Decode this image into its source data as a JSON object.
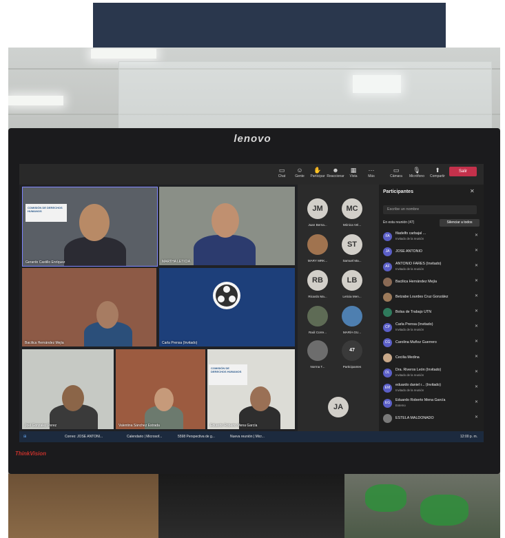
{
  "monitor": {
    "brand": "lenovo",
    "model": "ThinkVision"
  },
  "toolbar": {
    "buttons": [
      "Chat",
      "Gente",
      "Participar",
      "Reaccionar",
      "Vista",
      "Más",
      "Cámara",
      "Micrófono",
      "Compartir"
    ],
    "leave": "Salir"
  },
  "tiles": [
    {
      "name": "Gerardo Castillo Enríquez",
      "logo": "COMISIÓN DE DERECHOS HUMANOS"
    },
    {
      "name": "MARTHA LETICIA"
    },
    {
      "name": "Bacilica Hernández Mejía"
    },
    {
      "name": "Carla Prensa (Invitado)"
    },
    {
      "name": "Joel Gonzalez Perez"
    },
    {
      "name": "Valentina Sánchez Estrada"
    },
    {
      "name": "Eduardo Roberto Mena García",
      "logo": "COMISIÓN DE DERECHOS HUMANOS"
    }
  ],
  "avatars": [
    {
      "initials": "JM",
      "name": "Juan Berna..."
    },
    {
      "initials": "MC",
      "name": "Mónica Vel..."
    },
    {
      "initials": "",
      "name": "MARY MRK..."
    },
    {
      "initials": "ST",
      "name": "Samuel Ma..."
    },
    {
      "initials": "RB",
      "name": "Ricardo Ma..."
    },
    {
      "initials": "LB",
      "name": "Leticia Men..."
    },
    {
      "initials": "",
      "name": "Raúl Corre..."
    },
    {
      "initials": "",
      "name": "MARÍA GU..."
    },
    {
      "initials": "",
      "name": "Norma T..."
    },
    {
      "initials": "47",
      "name": "Participantes"
    },
    {
      "initials": "JA",
      "name": ""
    }
  ],
  "panel": {
    "title": "Participantes",
    "search_placeholder": "Escribe un nombre",
    "section": "En esta reunión (47)",
    "mute_all": "Silenciar a todos",
    "participants": [
      {
        "initials": "FA",
        "name": "filadelfo carbajal ... ",
        "sub": "Invitado de la reunión"
      },
      {
        "initials": "JA",
        "name": "JOSE ANTONIO",
        "sub": ""
      },
      {
        "initials": "AF",
        "name": "ANTONIO FARES (Invitado)",
        "sub": "Invitado de la reunión"
      },
      {
        "initials": "",
        "name": "Bacilica Hernández Mejía",
        "sub": ""
      },
      {
        "initials": "",
        "name": "Betzabe Lourdes Cruz González",
        "sub": ""
      },
      {
        "initials": "",
        "name": "Bolsa de Trabajo UTN",
        "sub": ""
      },
      {
        "initials": "CP",
        "name": "Carla Prensa (Invitado)",
        "sub": "Invitado de la reunión"
      },
      {
        "initials": "CG",
        "name": "Carolina Muñoz Guerrero",
        "sub": ""
      },
      {
        "initials": "",
        "name": "Cecilia Medina",
        "sub": ""
      },
      {
        "initials": "DL",
        "name": "Dra. Riveros León (Invitado)",
        "sub": "Invitado de la reunión"
      },
      {
        "initials": "EM",
        "name": "eduardo daniel r... (Invitado)",
        "sub": "Invitado de la reunión"
      },
      {
        "initials": "EG",
        "name": "Eduardo Roberto Mena García",
        "sub": "Externo"
      },
      {
        "initials": "",
        "name": "ESTELA MALDONADO",
        "sub": ""
      }
    ]
  },
  "taskbar": {
    "items": [
      "Correo: JOSE ANTONI...",
      "Calendario | Microsof...",
      "5598 Perspectiva de g...",
      "Nueva reunión | Micr..."
    ],
    "clock": "12:00 p. m."
  },
  "colors": {
    "teams_accent": "#5b5fc7",
    "leave_red": "#c4314b",
    "banner": "#2a374d"
  }
}
